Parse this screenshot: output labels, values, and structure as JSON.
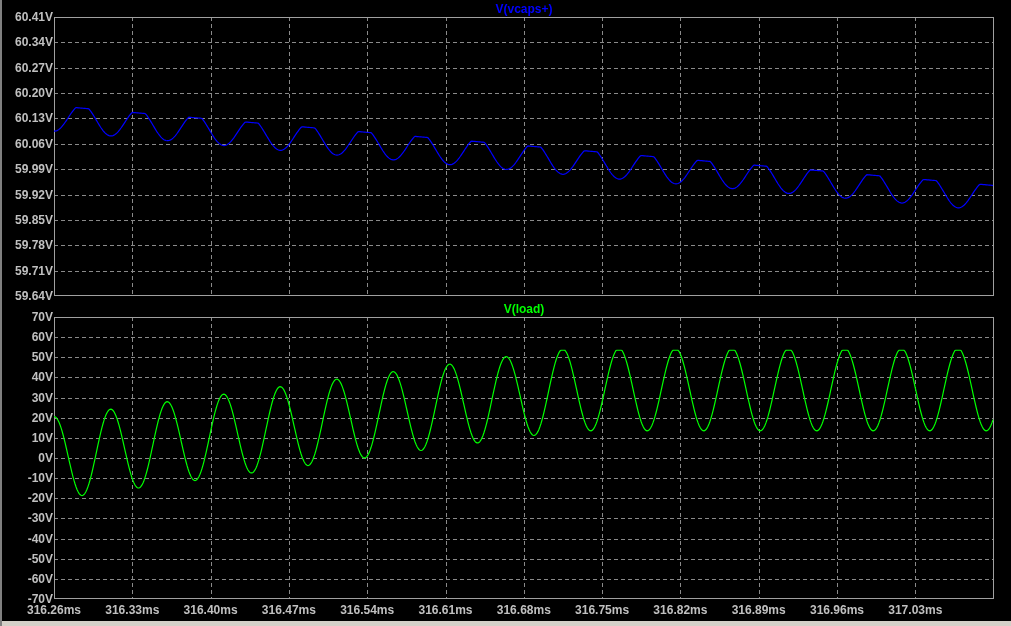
{
  "panes": [
    {
      "title": "V(vcaps+)",
      "color": "#0000ff",
      "y_ticks": [
        "60.41V",
        "60.34V",
        "60.27V",
        "60.20V",
        "60.13V",
        "60.06V",
        "59.99V",
        "59.92V",
        "59.85V",
        "59.78V",
        "59.71V",
        "59.64V"
      ]
    },
    {
      "title": "V(load)",
      "color": "#00ff00",
      "y_ticks": [
        "70V",
        "60V",
        "50V",
        "40V",
        "30V",
        "20V",
        "10V",
        "0V",
        "-10V",
        "-20V",
        "-30V",
        "-40V",
        "-50V",
        "-60V",
        "-70V"
      ]
    }
  ],
  "x_ticks": [
    "316.26ms",
    "316.33ms",
    "316.40ms",
    "316.47ms",
    "316.54ms",
    "316.61ms",
    "316.68ms",
    "316.75ms",
    "316.82ms",
    "316.89ms",
    "316.96ms",
    "317.03ms"
  ]
}
